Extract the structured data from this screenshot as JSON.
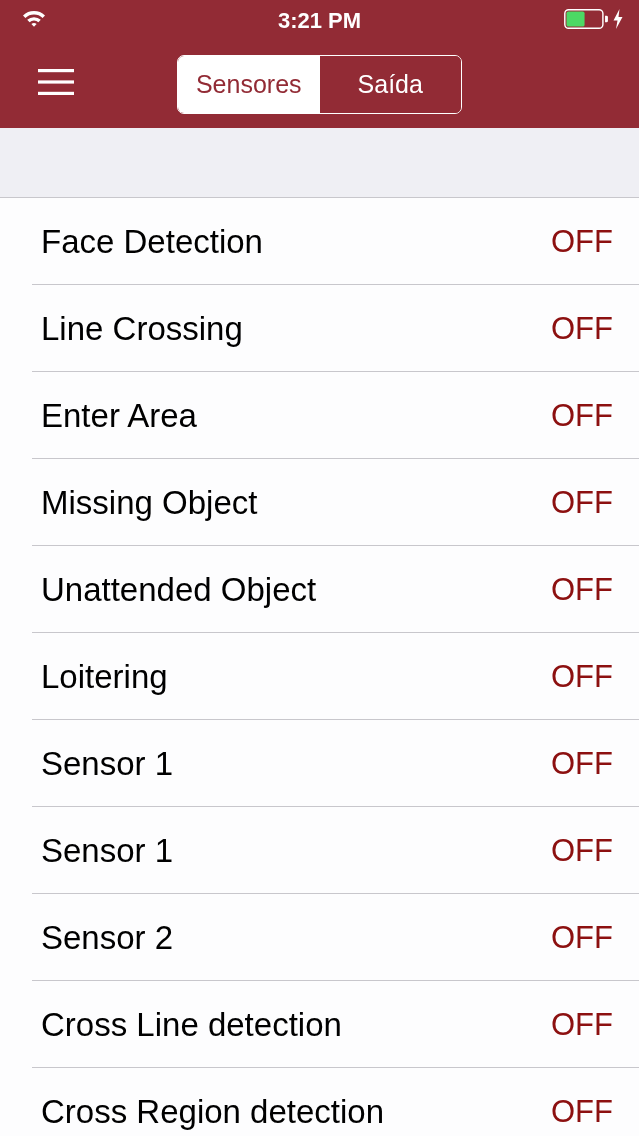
{
  "status_bar": {
    "time": "3:21 PM"
  },
  "nav_bar": {
    "segments": [
      {
        "label": "Sensores",
        "selected": true
      },
      {
        "label": "Saída",
        "selected": false
      }
    ]
  },
  "sensors": [
    {
      "name": "Face Detection",
      "state": "OFF"
    },
    {
      "name": "Line Crossing",
      "state": "OFF"
    },
    {
      "name": "Enter Area",
      "state": "OFF"
    },
    {
      "name": "Missing Object",
      "state": "OFF"
    },
    {
      "name": "Unattended Object",
      "state": "OFF"
    },
    {
      "name": "Loitering",
      "state": "OFF"
    },
    {
      "name": "Sensor 1",
      "state": "OFF"
    },
    {
      "name": "Sensor 1",
      "state": "OFF"
    },
    {
      "name": "Sensor 2",
      "state": "OFF"
    },
    {
      "name": "Cross Line detection",
      "state": "OFF"
    },
    {
      "name": "Cross Region detection",
      "state": "OFF"
    }
  ]
}
